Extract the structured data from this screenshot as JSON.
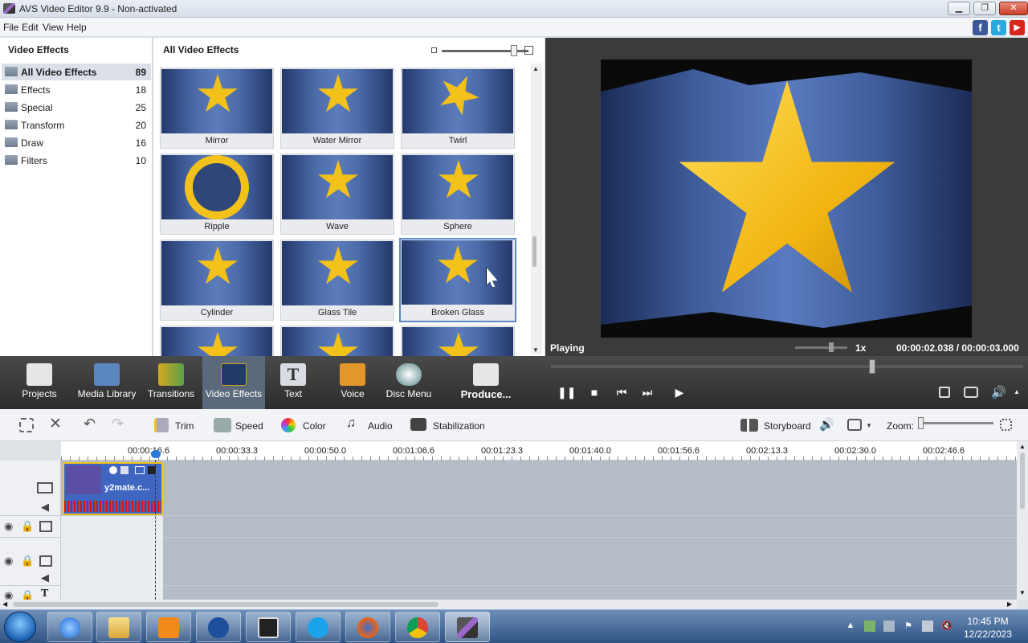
{
  "window": {
    "title": "AVS Video Editor 9.9 - Non-activated",
    "min_label": "▁",
    "restore_label": "❐",
    "close_label": "✕"
  },
  "menu": [
    "File",
    "Edit",
    "View",
    "Help"
  ],
  "social": [
    "f",
    "t",
    "▶"
  ],
  "left_panel": {
    "title": "Video Effects",
    "categories": [
      {
        "label": "All Video Effects",
        "count": "89"
      },
      {
        "label": "Effects",
        "count": "18"
      },
      {
        "label": "Special",
        "count": "25"
      },
      {
        "label": "Transform",
        "count": "20"
      },
      {
        "label": "Draw",
        "count": "16"
      },
      {
        "label": "Filters",
        "count": "10"
      }
    ]
  },
  "effects_panel": {
    "title": "All Video Effects",
    "tiles": [
      "Mirror",
      "Water Mirror",
      "Twirl",
      "Ripple",
      "Wave",
      "Sphere",
      "Cylinder",
      "Glass Tile",
      "Broken Glass"
    ],
    "selected": "Broken Glass"
  },
  "preview": {
    "status": "Playing",
    "speed": "1x",
    "timecode": "00:00:02.038 / 00:00:03.000",
    "seek_fraction": 0.68
  },
  "toolbar": {
    "items": [
      "Projects",
      "Media Library",
      "Transitions",
      "Video Effects",
      "Text",
      "Voice",
      "Disc Menu",
      "Produce..."
    ],
    "selected": "Video Effects"
  },
  "player_controls": {
    "pause": "❚❚",
    "stop": "■",
    "prev": "⏮",
    "next": "⏭",
    "frame": "▶"
  },
  "edit_toolbar": {
    "trim": "Trim",
    "speed": "Speed",
    "color": "Color",
    "audio": "Audio",
    "stabilization": "Stabilization",
    "storyboard": "Storyboard",
    "zoom": "Zoom:"
  },
  "ruler": [
    "00:00:16.6",
    "00:00:33.3",
    "00:00:50.0",
    "00:01:06.6",
    "00:01:23.3",
    "00:01:40.0",
    "00:01:56.6",
    "00:02:13.3",
    "00:02:30.0",
    "00:02:46.6"
  ],
  "clip": {
    "name": "y2mate.c..."
  },
  "taskbar": {
    "time": "10:45 PM",
    "date": "12/22/2023"
  },
  "colors": {
    "accent": "#5b87c4",
    "star": "#f2c21a",
    "toolbar": "#2c2c2c",
    "preview_bg": "#3b3b3b"
  }
}
